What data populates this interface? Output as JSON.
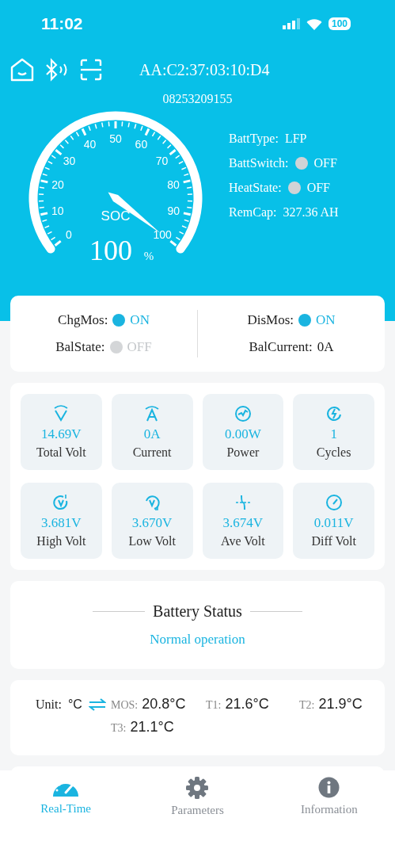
{
  "status_bar": {
    "time": "11:02",
    "battery": "100"
  },
  "header": {
    "device_id": "AA:C2:37:03:10:D4",
    "serial": "08253209155"
  },
  "gauge": {
    "label": "SOC",
    "value": "100",
    "unit": "%",
    "scale_labels": [
      "0",
      "10",
      "20",
      "30",
      "40",
      "50",
      "60",
      "70",
      "80",
      "90",
      "100"
    ]
  },
  "battery_info": [
    {
      "label": "BattType:",
      "value": "LFP",
      "kind": "text"
    },
    {
      "label": "BattSwitch:",
      "value": "OFF",
      "kind": "dot",
      "on": false
    },
    {
      "label": "HeatState:",
      "value": "OFF",
      "kind": "dot",
      "on": false
    },
    {
      "label": "RemCap:",
      "value": "327.36 AH",
      "kind": "text"
    }
  ],
  "mos_panel": {
    "left": [
      {
        "label": "ChgMos:",
        "value": "ON",
        "kind": "dot",
        "on": true
      },
      {
        "label": "BalState:",
        "value": "OFF",
        "kind": "dot",
        "on": false
      }
    ],
    "right": [
      {
        "label": "DisMos:",
        "value": "ON",
        "kind": "dot",
        "on": true
      },
      {
        "label": "BalCurrent:",
        "value": "0A",
        "kind": "text"
      }
    ]
  },
  "metrics": [
    {
      "value": "14.69V",
      "label": "Total Volt"
    },
    {
      "value": "0A",
      "label": "Current"
    },
    {
      "value": "0.00W",
      "label": "Power"
    },
    {
      "value": "1",
      "label": "Cycles"
    },
    {
      "value": "3.681V",
      "label": "High Volt"
    },
    {
      "value": "3.670V",
      "label": "Low Volt"
    },
    {
      "value": "3.674V",
      "label": "Ave Volt"
    },
    {
      "value": "0.011V",
      "label": "Diff Volt"
    }
  ],
  "battery_status": {
    "title": "Battery Status",
    "value": "Normal operation"
  },
  "temperature": {
    "unit_label": "Unit:",
    "unit": "°C",
    "readings": [
      {
        "label": "MOS:",
        "value": "20.8°C"
      },
      {
        "label": "T1:",
        "value": "21.6°C"
      },
      {
        "label": "T2:",
        "value": "21.9°C"
      },
      {
        "label": "T3:",
        "value": "21.1°C"
      }
    ]
  },
  "tabs": [
    {
      "label": "Real-Time",
      "selected": true
    },
    {
      "label": "Parameters",
      "selected": false
    },
    {
      "label": "Information",
      "selected": false
    }
  ]
}
